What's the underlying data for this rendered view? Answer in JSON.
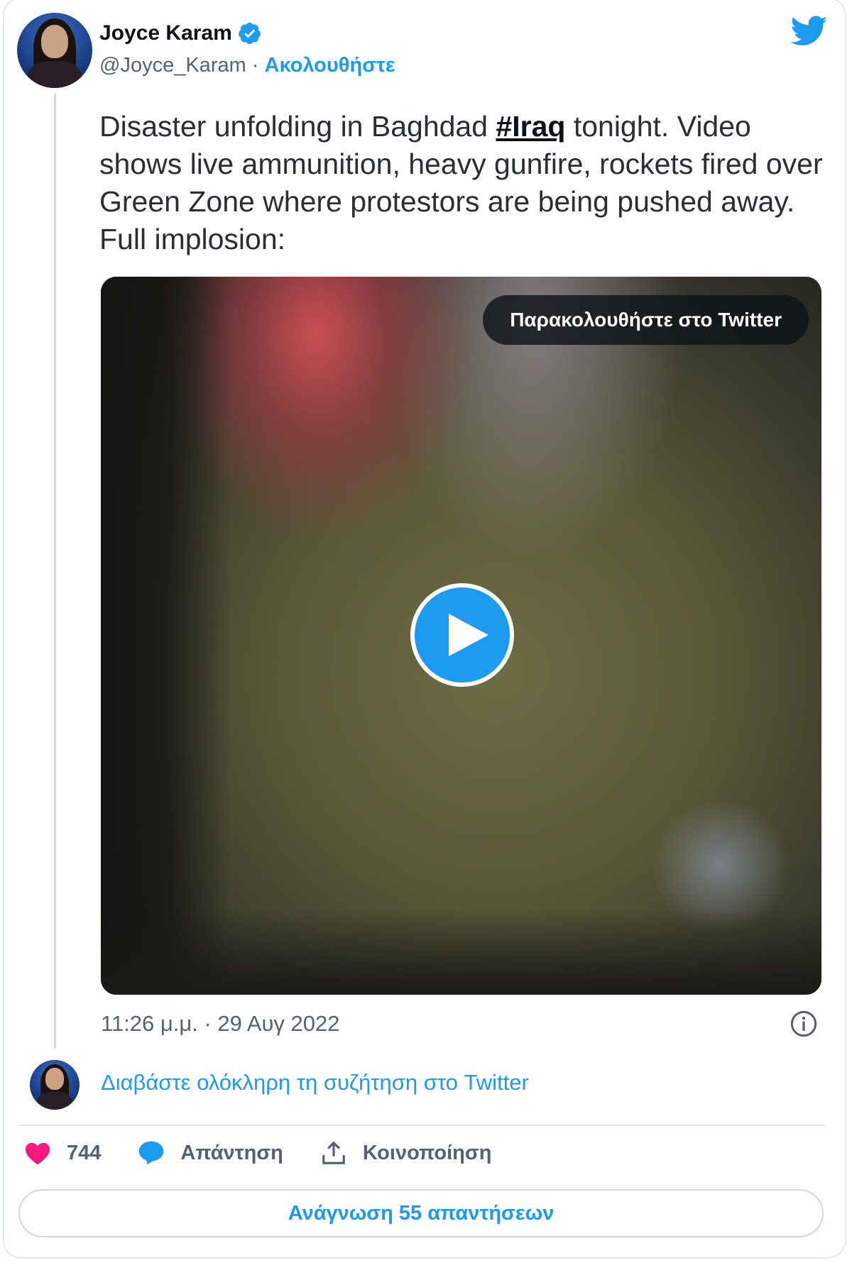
{
  "author": {
    "name": "Joyce Karam",
    "handle": "@Joyce_Karam",
    "separator": " · ",
    "follow_label": "Ακολουθήστε"
  },
  "tweet": {
    "text_before": "Disaster unfolding in Baghdad ",
    "hashtag": "#Iraq",
    "text_after": " tonight. Video shows live ammunition, heavy gunfire, rockets fired over Green Zone where protestors are being pushed away. Full implosion:"
  },
  "video": {
    "watch_label": "Παρακολουθήστε στο Twitter"
  },
  "timestamp": "11:26 μ.μ. · 29 Αυγ 2022",
  "read_conversation_label": "Διαβάστε ολόκληρη τη συζήτηση στο Twitter",
  "actions": {
    "likes": "744",
    "reply_label": "Απάντηση",
    "share_label": "Κοινοποίηση"
  },
  "read_replies_label": "Ανάγνωση 55 απαντήσεων",
  "colors": {
    "accent": "#1d9bf0",
    "like": "#f91880",
    "text_secondary": "#536471"
  },
  "icons": [
    "verified-badge-icon",
    "twitter-bird-icon",
    "play-icon",
    "info-icon",
    "heart-icon",
    "reply-bubble-icon",
    "share-icon"
  ]
}
